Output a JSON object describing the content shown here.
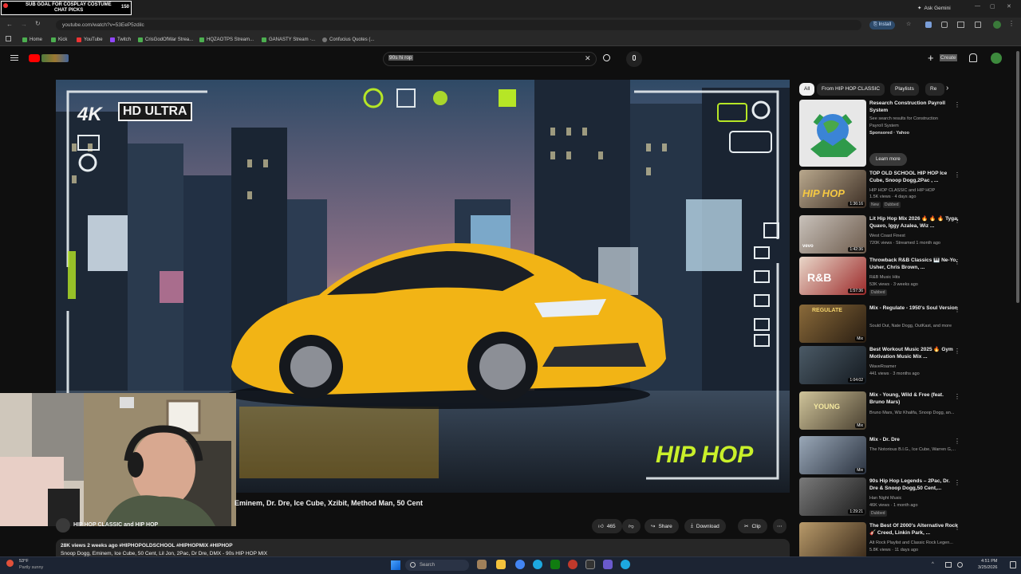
{
  "overlay": {
    "goal_text": "SUB GOAL FOR COSPLAY COSTUME",
    "sub_text": "CHAT PICKS",
    "count": "150"
  },
  "window": {
    "ask_label": "Ask Gemini"
  },
  "toolbar": {
    "url": "youtube.com/watch?v=53EeP5zdilc",
    "install_label": "Install"
  },
  "bookmarks": [
    "Home",
    "Kick",
    "YouTube",
    "Twitch",
    "CrisGodOfWar Strea...",
    "HQZAOTPS Stream...",
    "GANASTY Stream ·...",
    "Confucius Quotes (..."
  ],
  "header": {
    "search_query": "90s hi rop",
    "create_label": "Create"
  },
  "video": {
    "badge_text": "HD ULTRA",
    "corner_text": "4K",
    "hiphop_text": "HIP HOP",
    "title": "Eminem, Dr. Dre, Ice Cube, Xzibit, Method Man, 50 Cent",
    "channel": "HIP HOP CLASSIC and HIP HOP",
    "likes": "465",
    "share_label": "Share",
    "download_label": "Download",
    "clip_label": "Clip",
    "views_line": "28K views  2 weeks ago  #HIPHOPOLDSCHOOL #HIPHOPMIX #HIPHOP",
    "desc_line": "Snoop Dogg, Eminem, Ice Cube, 50 Cent, Lil Jon, 2Pac, Dr Dre, DMX - 90s HIP HOP MIX"
  },
  "chips": [
    "All",
    "From HIP HOP CLASSIC",
    "Playlists",
    "Re"
  ],
  "recommendations": [
    {
      "title": "Research Construction Payroll System",
      "lines": [
        "See search results for Construction",
        "Payroll System",
        "Sponsored · Yahoo"
      ],
      "button": "Learn more",
      "duration": ""
    },
    {
      "title": "TOP OLD SCHOOL HIP HOP Ice Cube, Snoop Dogg,2Pac , ...",
      "lines": [
        "HIP HOP CLASSIC and HIP HOP",
        "1.5K views · 4 days ago"
      ],
      "badges": [
        "New",
        "Dubbed"
      ],
      "duration": "1:36:16"
    },
    {
      "title": "Lit Hip Hop Mix 2026 🔥 🔥 🔥 Tyga, Quavo, Iggy Azalea, Wiz ...",
      "lines": [
        "West Coast Finest",
        "720K views · Streamed 1 month ago"
      ],
      "duration": "1:42:36"
    },
    {
      "title": "Throwback R&B Classics 🎹 Ne-Yo, Usher, Chris Brown, ...",
      "lines": [
        "R&B Music Hits",
        "53K views · 3 weeks ago"
      ],
      "badges": [
        "Dubbed"
      ],
      "duration": "1:57:36"
    },
    {
      "title": "Mix - Regulate - 1950's Soul Version",
      "lines": [
        "Sould Out, Nate Dogg, OutKast, and more"
      ],
      "duration": "Mix"
    },
    {
      "title": "Best Workout Music 2025 🔥 Gym Motivation Music Mix ...",
      "lines": [
        "WaveRoamer",
        "441 views · 3 months ago"
      ],
      "duration": "1:04:02"
    },
    {
      "title": "Mix - Young, Wild & Free (feat. Bruno Mars)",
      "lines": [
        "Bruno Mars, Wiz Khalifa, Snoop Dogg, an..."
      ],
      "duration": "Mix"
    },
    {
      "title": "Mix - Dr. Dre",
      "lines": [
        "The Notorious B.I.G., Ice Cube, Warren G,..."
      ],
      "duration": "Mix"
    },
    {
      "title": "90s Hip Hop Legends – 2Pac, Dr. Dre & Snoop Dogg,50 Cent,...",
      "lines": [
        "Han Night Music",
        "46K views · 1 month ago"
      ],
      "badges": [
        "Dubbed"
      ],
      "duration": "1:29:21"
    },
    {
      "title": "The Best Of 2000's Alternative Rock 🎸 Creed, Linkin Park, ...",
      "lines": [
        "Alt Rock Playlist and Classic Rock Legen...",
        "5.8K views · 11 days ago"
      ],
      "duration": ""
    }
  ],
  "taskbar": {
    "weather_temp": "53°F",
    "weather_desc": "Partly sunny",
    "search_label": "Search",
    "time": "4:51 PM",
    "date": "3/25/2026"
  },
  "colors": {
    "brand_red": "#ff0000",
    "bg": "#0f0f0f",
    "car_yellow": "#f2b415",
    "accent_green": "#b6e626"
  }
}
